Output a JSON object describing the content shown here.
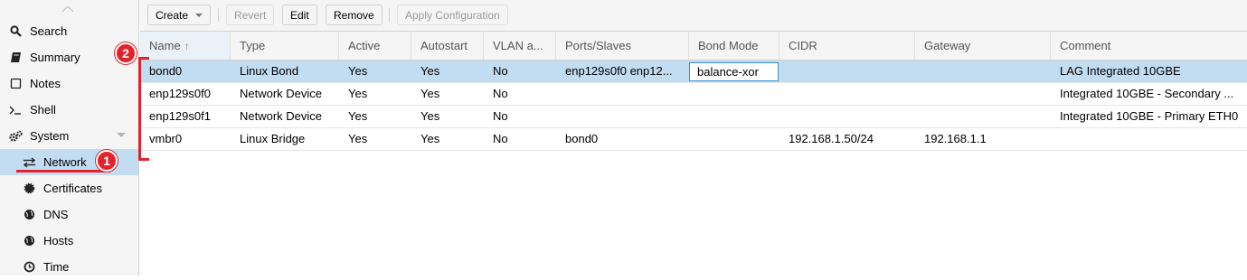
{
  "sidebar": {
    "items": [
      {
        "label": "Search",
        "icon": "search-icon"
      },
      {
        "label": "Summary",
        "icon": "book-icon"
      },
      {
        "label": "Notes",
        "icon": "note-icon"
      },
      {
        "label": "Shell",
        "icon": "terminal-icon"
      },
      {
        "label": "System",
        "icon": "gears-icon"
      },
      {
        "label": "Network",
        "icon": "exchange-icon",
        "selected": true
      },
      {
        "label": "Certificates",
        "icon": "certificate-icon"
      },
      {
        "label": "DNS",
        "icon": "globe-icon"
      },
      {
        "label": "Hosts",
        "icon": "globe-icon"
      },
      {
        "label": "Time",
        "icon": "clock-icon"
      }
    ]
  },
  "toolbar": {
    "create": "Create",
    "revert": "Revert",
    "edit": "Edit",
    "remove": "Remove",
    "apply": "Apply Configuration"
  },
  "grid": {
    "columns": [
      "Name",
      "Type",
      "Active",
      "Autostart",
      "VLAN a...",
      "Ports/Slaves",
      "Bond Mode",
      "CIDR",
      "Gateway",
      "Comment"
    ],
    "sort_column": "Name",
    "sort_direction": "ascending",
    "rows": [
      [
        "bond0",
        "Linux Bond",
        "Yes",
        "Yes",
        "No",
        "enp129s0f0 enp12...",
        "balance-xor",
        "",
        "",
        "LAG Integrated 10GBE"
      ],
      [
        "enp129s0f0",
        "Network Device",
        "Yes",
        "Yes",
        "No",
        "",
        "",
        "",
        "",
        "Integrated 10GBE - Secondary ..."
      ],
      [
        "enp129s0f1",
        "Network Device",
        "Yes",
        "Yes",
        "No",
        "",
        "",
        "",
        "",
        "Integrated 10GBE - Primary ETH0"
      ],
      [
        "vmbr0",
        "Linux Bridge",
        "Yes",
        "Yes",
        "No",
        "bond0",
        "",
        "192.168.1.50/24",
        "192.168.1.1",
        ""
      ]
    ],
    "selected_row": 0,
    "editing_cell": "Bond Mode"
  },
  "callouts": [
    "1",
    "2"
  ],
  "colors": {
    "selection": "#c2dcf2",
    "callout_red": "#e3232b",
    "editor_border": "#3892d4"
  }
}
